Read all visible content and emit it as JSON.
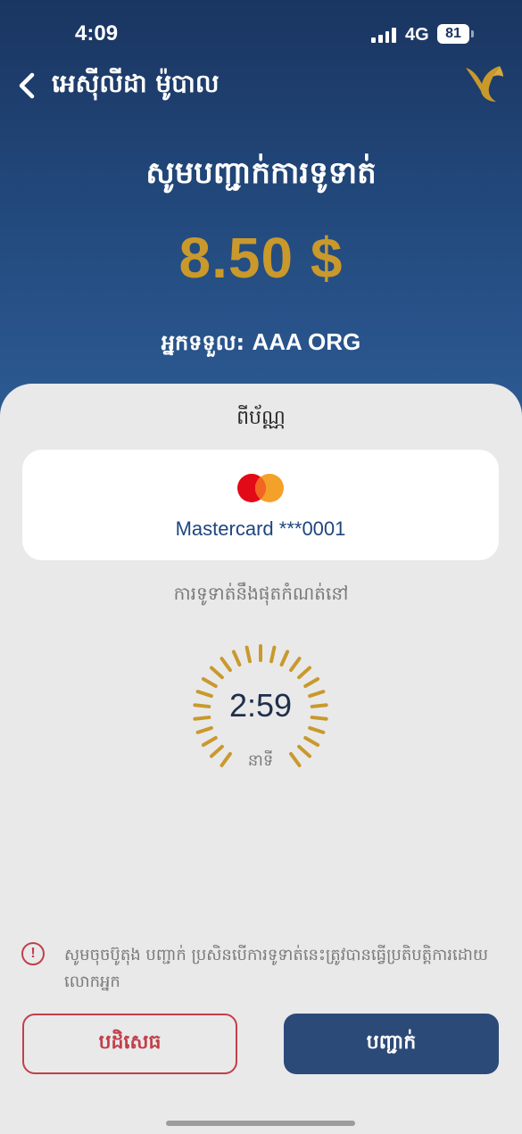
{
  "status_bar": {
    "time": "4:09",
    "network": "4G",
    "battery": "81"
  },
  "header": {
    "title": "អេស៊ីលីដា ម៉ូបាល",
    "back_icon": "chevron-left-icon",
    "logo_icon": "bird-logo-icon"
  },
  "payment": {
    "heading": "សូមបញ្ជាក់ការទូទាត់",
    "amount": "8.50 $",
    "receiver_label": "អ្នកទទួល: ",
    "receiver_name": "AAA ORG"
  },
  "source": {
    "label": "ពីប័ណ្ណ",
    "card_text": "Mastercard ***0001",
    "card_brand_icon": "mastercard-icon"
  },
  "timer": {
    "label": "ការទូទាត់នឹងផុតកំណត់នៅ",
    "value": "2:59",
    "unit": "នាទី"
  },
  "notice": {
    "icon": "!",
    "text": "សូមចុចប៊ូតុង បញ្ជាក់ ប្រសិនបើការទូទាត់នេះត្រូវបានធ្វើប្រតិបត្តិការដោយលោកអ្នក"
  },
  "actions": {
    "reject_label": "បដិសេធ",
    "confirm_label": "បញ្ជាក់"
  },
  "colors": {
    "brand_dark": "#1a3561",
    "gold": "#c9992c",
    "danger": "#c2404a",
    "confirm": "#2c4a78"
  }
}
